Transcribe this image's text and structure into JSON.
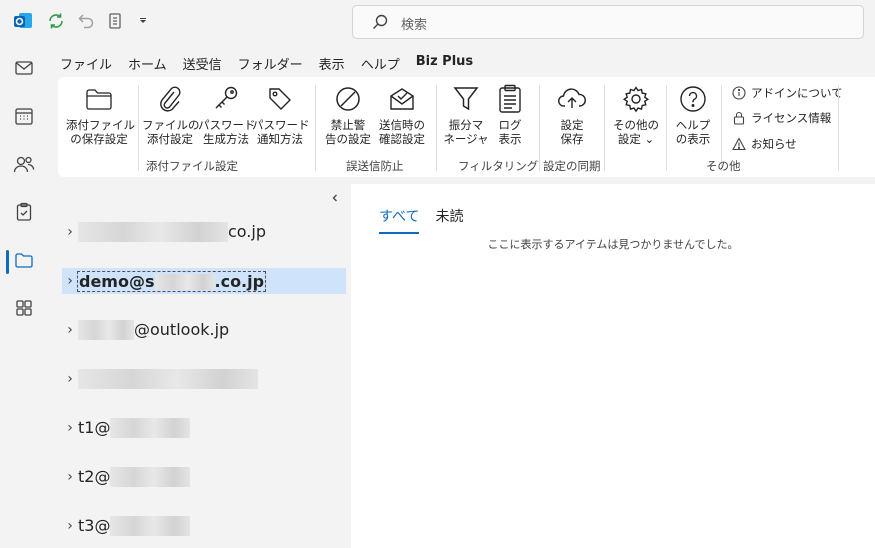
{
  "app": {
    "name": "Outlook",
    "brand_color": "#0f6cbd"
  },
  "search": {
    "placeholder": "検索"
  },
  "menu_tabs": [
    {
      "label": "ファイル"
    },
    {
      "label": "ホーム"
    },
    {
      "label": "送受信"
    },
    {
      "label": "フォルダー"
    },
    {
      "label": "表示"
    },
    {
      "label": "ヘルプ"
    },
    {
      "label": "Biz Plus",
      "active": true
    }
  ],
  "ribbon": {
    "buttons": [
      {
        "label": "添付ファイル\nの保存設定",
        "icon": "folder-icon"
      },
      {
        "label": "ファイルの\n添付設定",
        "icon": "paperclip-icon"
      },
      {
        "label": "パスワード\n生成方法",
        "icon": "key-icon"
      },
      {
        "label": "パスワード\n通知方法",
        "icon": "tag-icon"
      },
      {
        "label": "禁止警\n告の設定",
        "icon": "prohibited-icon"
      },
      {
        "label": "送信時の\n確認設定",
        "icon": "mail-check-icon"
      },
      {
        "label": "振分マ\nネージャ",
        "icon": "filter-icon"
      },
      {
        "label": "ログ\n表示",
        "icon": "clipboard-icon"
      },
      {
        "label": "設定\n保存",
        "icon": "cloud-upload-icon"
      },
      {
        "label": "その他の\n設定 ⌄",
        "icon": "gear-icon"
      },
      {
        "label": "ヘルプ\nの表示",
        "icon": "help-icon"
      }
    ],
    "groups": [
      {
        "label": "添付ファイル設定"
      },
      {
        "label": "誤送信防止"
      },
      {
        "label": "フィルタリング"
      },
      {
        "label": "設定の同期"
      },
      {
        "label": "その他"
      }
    ],
    "small_items": [
      {
        "label": "アドインについて",
        "icon": "info-icon"
      },
      {
        "label": "ライセンス情報",
        "icon": "lock-icon"
      },
      {
        "label": "お知らせ",
        "icon": "warning-icon"
      }
    ]
  },
  "accounts": [
    {
      "prefix": "",
      "suffix": "co.jp"
    },
    {
      "prefix": "demo@s",
      "suffix": ".co.jp",
      "selected": true
    },
    {
      "prefix": "",
      "suffix": "@outlook.jp"
    },
    {
      "prefix": "",
      "suffix": ""
    },
    {
      "prefix": "t1@",
      "suffix": ""
    },
    {
      "prefix": "t2@",
      "suffix": ""
    },
    {
      "prefix": "t3@",
      "suffix": ""
    }
  ],
  "message_list": {
    "filters": [
      {
        "label": "すべて",
        "active": true
      },
      {
        "label": "未読"
      }
    ],
    "empty_text": "ここに表示するアイテムは見つかりませんでした。"
  }
}
